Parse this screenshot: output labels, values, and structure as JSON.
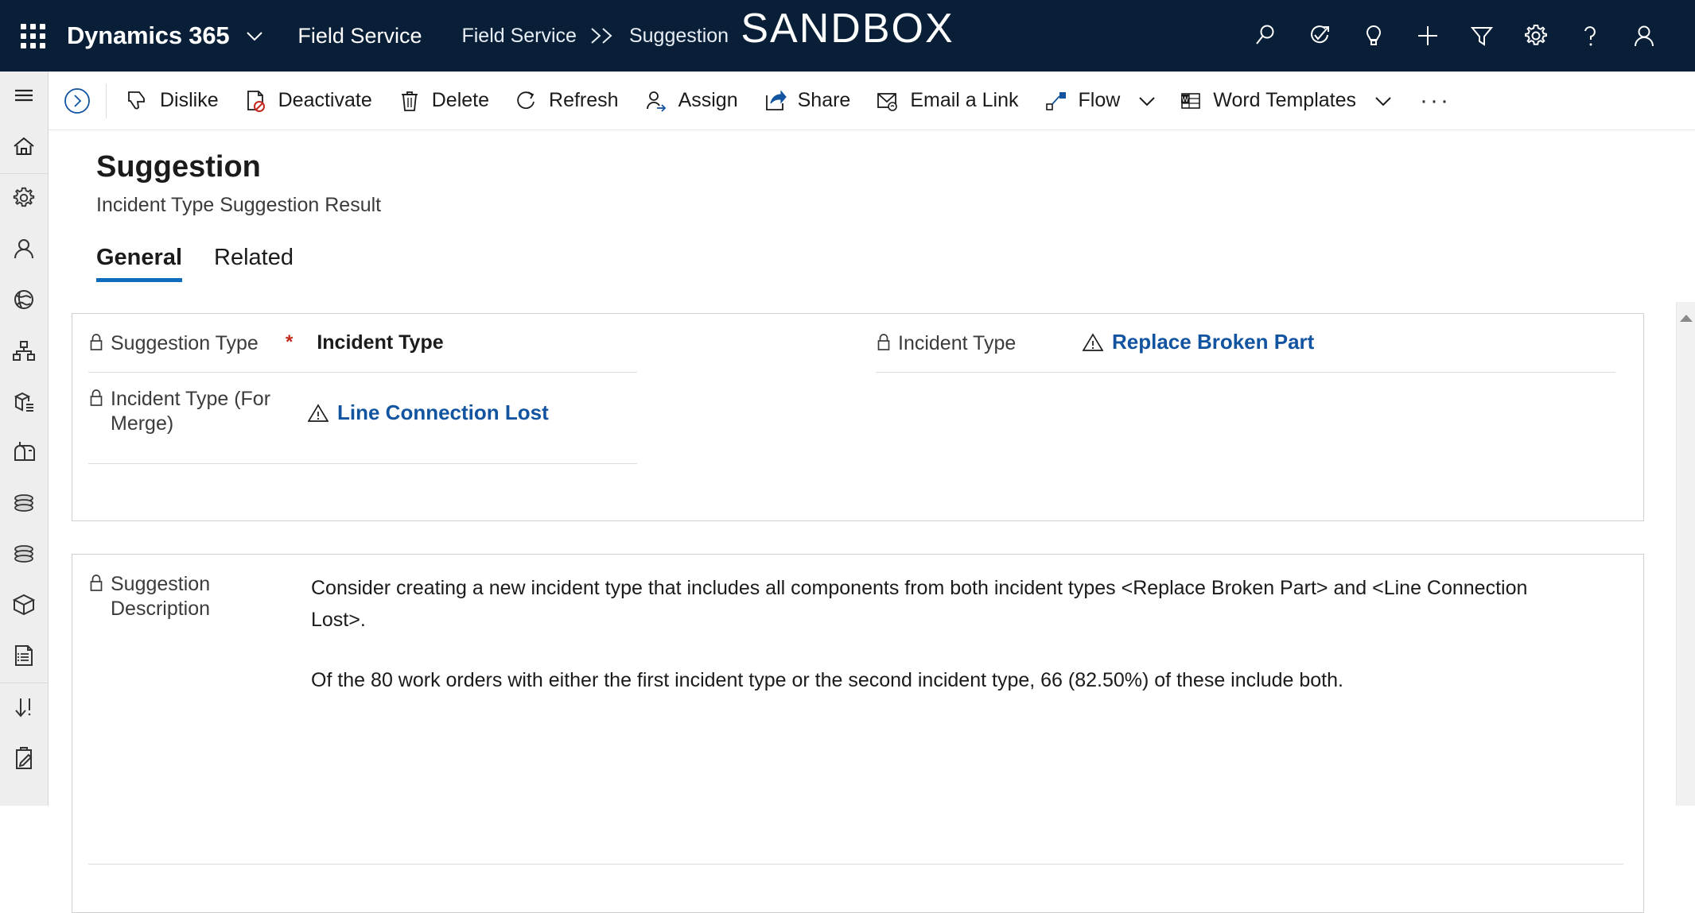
{
  "topnav": {
    "waffle_label": "app-launcher",
    "brand": "Dynamics 365",
    "app_name": "Field Service",
    "breadcrumb": [
      {
        "label": "Field Service"
      },
      {
        "label": "Suggestion"
      }
    ],
    "breadcrumb_separator": "››",
    "environment_banner": "SANDBOX",
    "icons": [
      {
        "name": "search-icon"
      },
      {
        "name": "assistant-icon"
      },
      {
        "name": "lightbulb-icon"
      },
      {
        "name": "add-icon"
      },
      {
        "name": "filter-icon"
      },
      {
        "name": "settings-gear-icon"
      },
      {
        "name": "help-question-icon"
      },
      {
        "name": "user-profile-icon"
      }
    ]
  },
  "sidebar": {
    "items": [
      {
        "name": "site-map-hamburger-icon"
      },
      {
        "name": "home-icon"
      },
      {
        "name": "settings-gear-icon"
      },
      {
        "name": "person-icon"
      },
      {
        "name": "globe-icon"
      },
      {
        "name": "org-hierarchy-icon"
      },
      {
        "name": "product-catalog-icon"
      },
      {
        "name": "mailbox-icon"
      },
      {
        "name": "database-stack-icon"
      },
      {
        "name": "database-stack-alt-icon"
      },
      {
        "name": "package-box-icon"
      },
      {
        "name": "document-list-icon"
      },
      {
        "name": "sort-priority-icon"
      },
      {
        "name": "clipboard-edit-icon"
      }
    ]
  },
  "commandbar": {
    "back_icon": "collapse-chevron-icon",
    "buttons": [
      {
        "icon": "thumbs-down-icon",
        "label": "Dislike"
      },
      {
        "icon": "deactivate-icon",
        "label": "Deactivate"
      },
      {
        "icon": "trash-icon",
        "label": "Delete"
      },
      {
        "icon": "refresh-icon",
        "label": "Refresh"
      },
      {
        "icon": "assign-person-icon",
        "label": "Assign"
      },
      {
        "icon": "share-icon",
        "label": "Share"
      },
      {
        "icon": "email-link-icon",
        "label": "Email a Link"
      },
      {
        "icon": "flow-icon",
        "label": "Flow",
        "has_caret": true
      },
      {
        "icon": "word-template-icon",
        "label": "Word Templates",
        "has_caret": true
      }
    ],
    "overflow_label": "···"
  },
  "page": {
    "title": "Suggestion",
    "subtitle": "Incident Type Suggestion Result",
    "tabs": [
      {
        "label": "General",
        "active": true
      },
      {
        "label": "Related",
        "active": false
      }
    ]
  },
  "form": {
    "suggestion_type": {
      "label": "Suggestion Type",
      "required_marker": "*",
      "value": "Incident Type"
    },
    "incident_type_for_merge": {
      "label": "Incident Type (For Merge)",
      "value": "Line Connection Lost",
      "icon": "warning-triangle-icon"
    },
    "incident_type": {
      "label": "Incident Type",
      "value": "Replace Broken Part",
      "icon": "warning-triangle-icon"
    },
    "suggestion_description": {
      "label": "Suggestion Description",
      "paragraph_1": "Consider creating a new incident type that includes all components from both incident types <Replace Broken Part> and <Line Connection Lost>.",
      "paragraph_2": "Of the 80 work orders with either the first incident type or the second incident type, 66 (82.50%) of these include both."
    }
  },
  "scrollbar": {
    "up_arrow": "scroll-up-arrow-icon"
  },
  "colors": {
    "nav_background": "#091f38",
    "accent_blue": "#0f6cbd",
    "link_blue": "#1254a0",
    "required_red": "#c3281c",
    "sidebar_background": "#eeeeee",
    "card_border": "#cfcfcf"
  }
}
